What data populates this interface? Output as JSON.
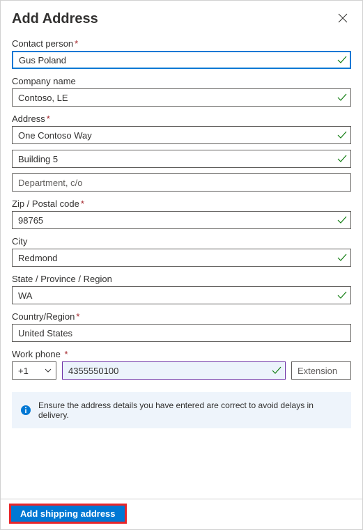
{
  "header": {
    "title": "Add Address"
  },
  "fields": {
    "contact": {
      "label": "Contact person",
      "value": "Gus Poland",
      "required": true
    },
    "company": {
      "label": "Company name",
      "value": "Contoso, LE",
      "required": false
    },
    "address": {
      "label": "Address",
      "required": true,
      "line1": "One Contoso Way",
      "line2": "Building 5",
      "line3_placeholder": "Department, c/o"
    },
    "zip": {
      "label": "Zip / Postal code",
      "value": "98765",
      "required": true
    },
    "city": {
      "label": "City",
      "value": "Redmond",
      "required": false
    },
    "state": {
      "label": "State / Province / Region",
      "value": "WA",
      "required": false
    },
    "country": {
      "label": "Country/Region",
      "value": "United States",
      "required": true
    },
    "phone": {
      "label": "Work phone",
      "required": true,
      "code": "+1",
      "number": "4355550100",
      "ext_placeholder": "Extension"
    }
  },
  "info": "Ensure the address details you have entered are correct to avoid delays in delivery.",
  "footer": {
    "submit": "Add shipping address"
  }
}
